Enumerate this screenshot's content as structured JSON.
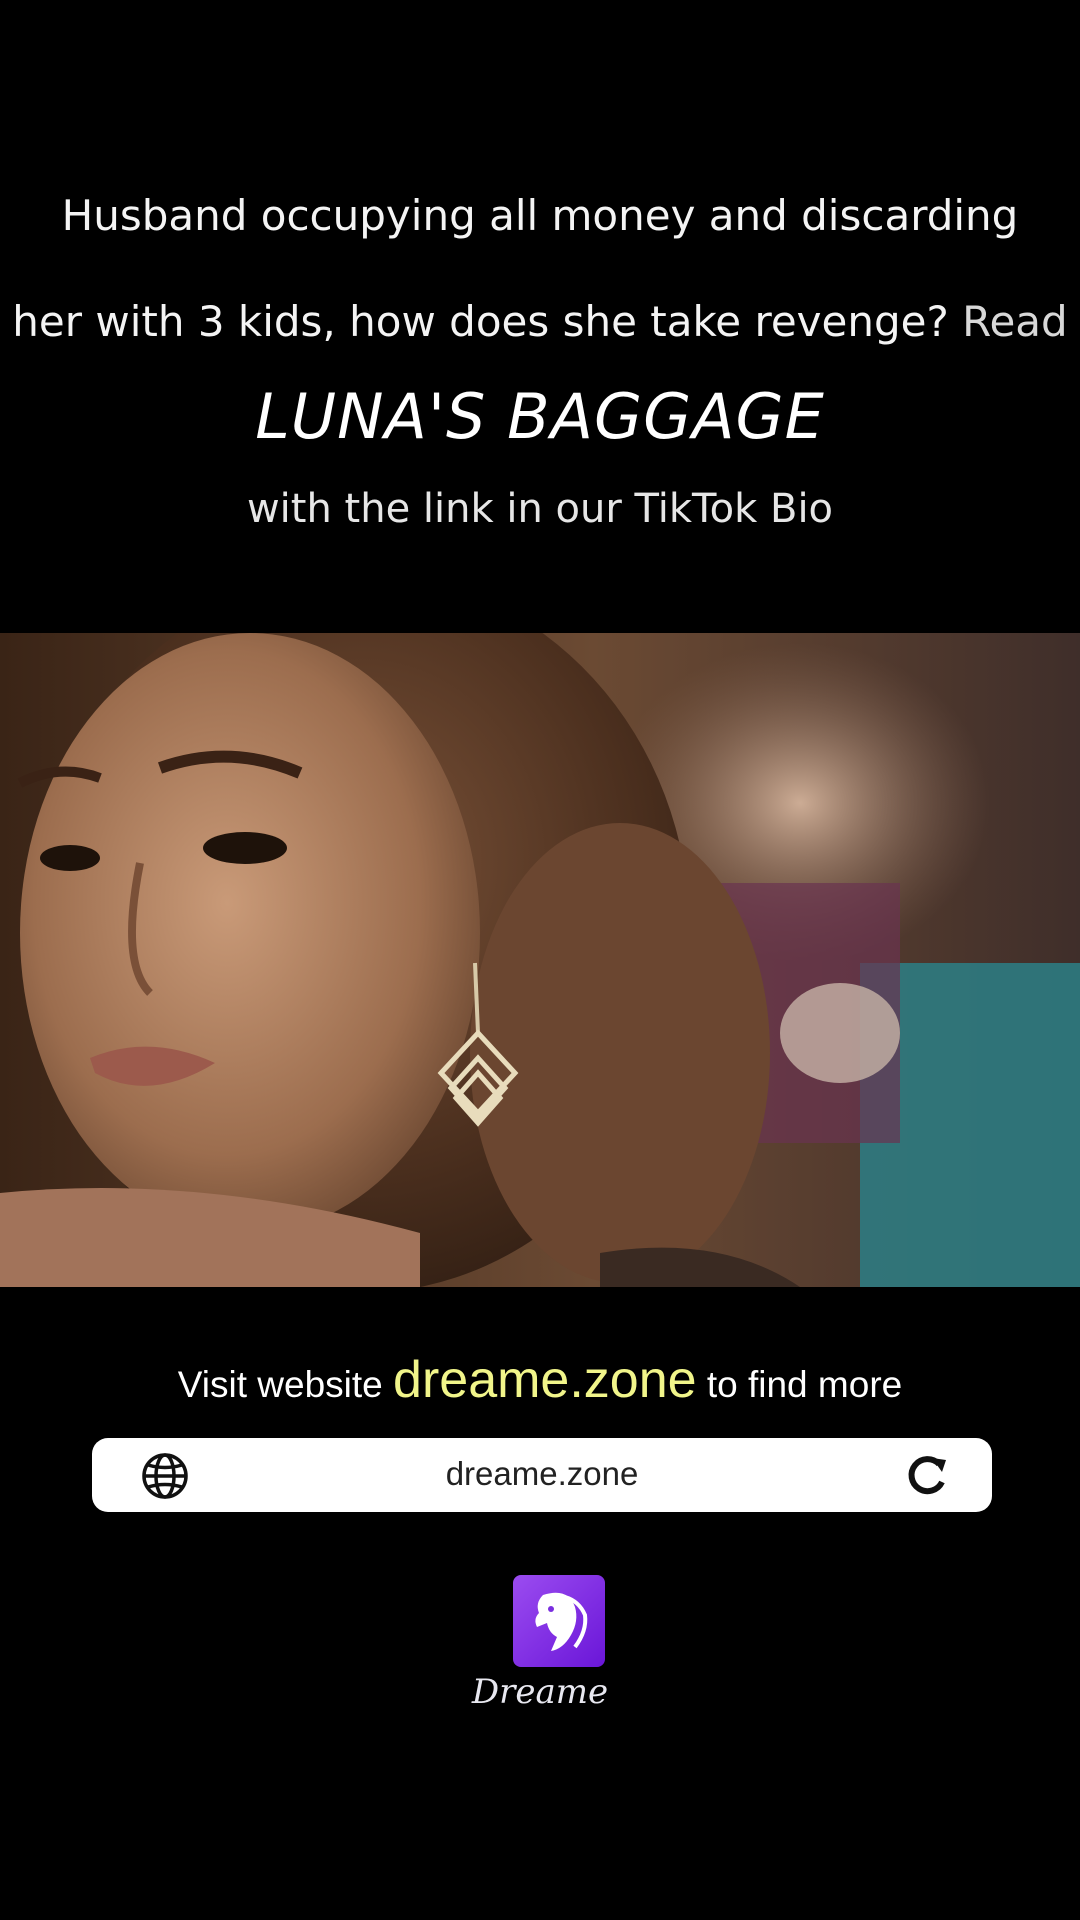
{
  "caption": {
    "line1": "Husband occupying all money and discarding",
    "line2": "her with 3 kids, how does she take revenge?",
    "read": "Read",
    "title": "LUNA'S BAGGAGE",
    "subline": "with the link in our TikTok Bio"
  },
  "promo": {
    "visit_prefix": "Visit website",
    "domain": "dreame.zone",
    "visit_suffix": "to find more"
  },
  "urlbar": {
    "url": "dreame.zone",
    "left_icon": "globe-icon",
    "right_icon": "reload-icon"
  },
  "brand": {
    "name": "Dreame",
    "accent": "#8a2be2",
    "link_color": "#f1f58a"
  }
}
